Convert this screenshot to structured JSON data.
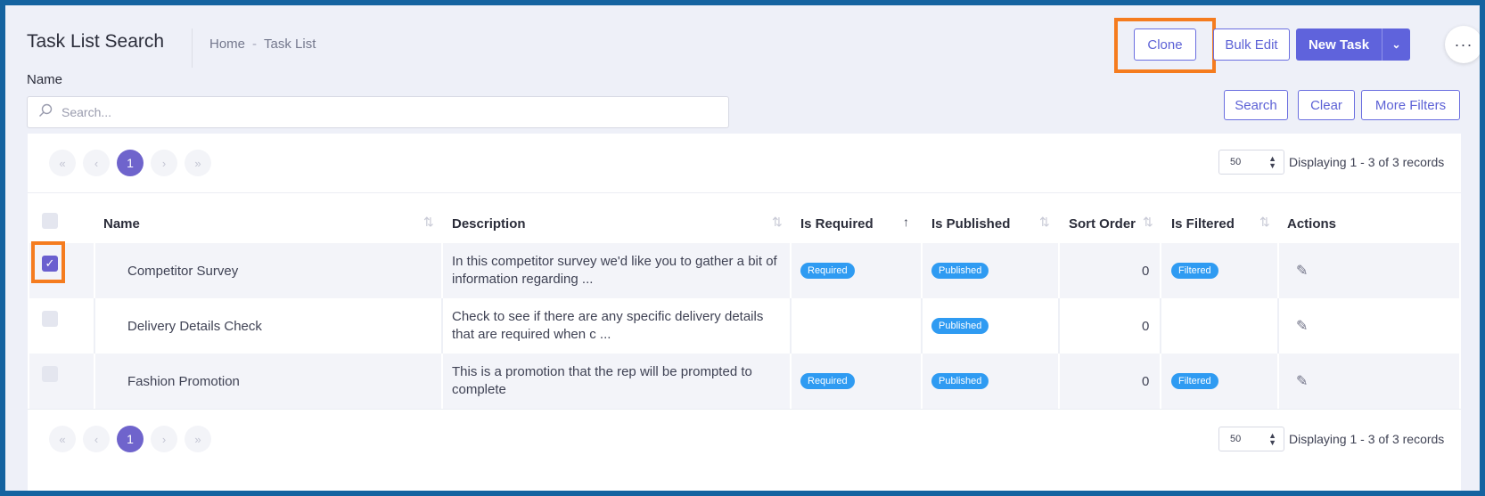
{
  "header": {
    "title": "Task List Search",
    "breadcrumb": [
      "Home",
      "Task List"
    ],
    "breadcrumb_sep": "-"
  },
  "toolbar": {
    "clone_label": "Clone",
    "bulk_edit_label": "Bulk Edit",
    "new_task_label": "New Task",
    "new_task_caret": "⌄",
    "more_label": "···"
  },
  "filters": {
    "name_label": "Name",
    "search_placeholder": "Search...",
    "search_label": "Search",
    "clear_label": "Clear",
    "more_filters_label": "More Filters"
  },
  "pagination": {
    "current_page": "1",
    "per_page": "50",
    "display_text": "Displaying 1 - 3 of 3 records"
  },
  "table": {
    "columns": [
      "Name",
      "Description",
      "Is Required",
      "Is Published",
      "Sort Order",
      "Is Filtered",
      "Actions"
    ],
    "rows": [
      {
        "checked": true,
        "name": "Competitor Survey",
        "description": "In this competitor survey we'd like you to gather a bit of information regarding ...",
        "required": "Required",
        "published": "Published",
        "sort_order": "0",
        "filtered": "Filtered"
      },
      {
        "checked": false,
        "name": "Delivery Details Check",
        "description": "Check to see if there are any specific delivery details that are required when c ...",
        "required": "",
        "published": "Published",
        "sort_order": "0",
        "filtered": ""
      },
      {
        "checked": false,
        "name": "Fashion Promotion",
        "description": "This is a promotion that the rep will be prompted to complete",
        "required": "Required",
        "published": "Published",
        "sort_order": "0",
        "filtered": "Filtered"
      }
    ]
  },
  "colors": {
    "accent": "#5f63dc",
    "badge": "#2f9bf2",
    "highlight": "#f57c1f",
    "frame": "#1463a0"
  }
}
